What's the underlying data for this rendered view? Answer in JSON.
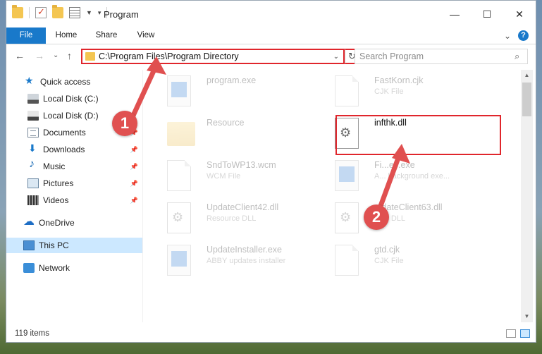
{
  "window": {
    "title": "Program",
    "controls": {
      "minimize": "—",
      "maximize": "☐",
      "close": "✕"
    }
  },
  "ribbon": {
    "tabs": [
      {
        "label": "File"
      },
      {
        "label": "Home"
      },
      {
        "label": "Share"
      },
      {
        "label": "View"
      }
    ],
    "expand_icon": "⌄",
    "help_icon": "?"
  },
  "nav": {
    "back": "←",
    "forward": "→",
    "recent": "⌄",
    "up": "↑",
    "address": "C:\\Program Files\\Program Directory",
    "address_dropdown": "⌄",
    "refresh": "↻",
    "search_placeholder": "Search Program",
    "search_icon": "⌕"
  },
  "sidebar": {
    "items": [
      {
        "label": "Quick access",
        "icon": "star-icon",
        "pinned": false
      },
      {
        "label": "Local Disk (C:)",
        "icon": "disk-icon",
        "pinned": false
      },
      {
        "label": "Local Disk (D:)",
        "icon": "disk-icon",
        "pinned": false
      },
      {
        "label": "Documents",
        "icon": "documents-icon",
        "pinned": true
      },
      {
        "label": "Downloads",
        "icon": "downloads-icon",
        "pinned": true
      },
      {
        "label": "Music",
        "icon": "music-icon",
        "pinned": true
      },
      {
        "label": "Pictures",
        "icon": "pictures-icon",
        "pinned": true
      },
      {
        "label": "Videos",
        "icon": "videos-icon",
        "pinned": true
      },
      {
        "label": "OneDrive",
        "icon": "onedrive-icon",
        "pinned": false
      },
      {
        "label": "This PC",
        "icon": "this-pc-icon",
        "pinned": false,
        "selected": true
      },
      {
        "label": "Network",
        "icon": "network-icon",
        "pinned": false
      }
    ],
    "pin_glyph": "📌"
  },
  "files": [
    {
      "name": "program.exe",
      "desc": "",
      "type": "exe"
    },
    {
      "name": "FastKorn.cjk",
      "desc": "CJK File",
      "type": "doc"
    },
    {
      "name": "Resource",
      "desc": "",
      "type": "folder"
    },
    {
      "name": "infthk.dll",
      "desc": "",
      "type": "dll",
      "focused": true
    },
    {
      "name": "SndToWP13.wcm",
      "desc": "WCM File",
      "type": "doc"
    },
    {
      "name": "Fi...ec.exe",
      "desc": "A... background exe...",
      "type": "exe"
    },
    {
      "name": "UpdateClient42.dll",
      "desc": "Resource DLL",
      "type": "dll"
    },
    {
      "name": "...dateClient63.dll",
      "desc": "...ce DLL",
      "type": "dll"
    },
    {
      "name": "UpdateInstaller.exe",
      "desc": "ABBY updates installer",
      "type": "exe"
    },
    {
      "name": "gtd.cjk",
      "desc": "CJK File",
      "type": "doc"
    }
  ],
  "status": {
    "item_count": "119 items"
  },
  "annotations": {
    "step1": "1",
    "step2": "2",
    "accent": "#e0262c"
  }
}
